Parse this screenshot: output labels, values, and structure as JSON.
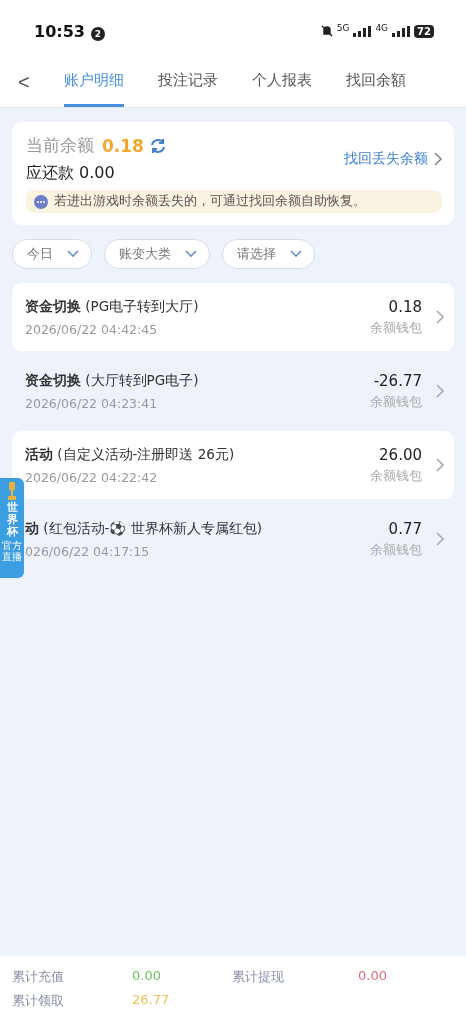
{
  "status_bar": {
    "time": "10:53",
    "notification_count": "2",
    "network_labels": [
      "5G",
      "4G"
    ],
    "battery": "72"
  },
  "nav": {
    "back": "<",
    "tabs": [
      {
        "label": "账户明细",
        "selected": true
      },
      {
        "label": "投注记录",
        "selected": false
      },
      {
        "label": "个人报表",
        "selected": false
      },
      {
        "label": "找回余額",
        "selected": false
      }
    ]
  },
  "balance_card": {
    "label": "当前余额",
    "amount": "0.18",
    "repay_label": "应还款 0.00",
    "recover_link": "找回丢失余额",
    "notice": "若进出游戏时余额丢失的，可通过找回余额自助恢复。"
  },
  "filters": [
    {
      "label": "今日"
    },
    {
      "label": "账变大类"
    },
    {
      "label": "请选择"
    }
  ],
  "records": [
    {
      "title": "**资金切换** (PG电子转到大厅)",
      "time": "2026/06/22 04:42:45",
      "amount": "0.18",
      "wallet": "余额钱包",
      "highlighted": true
    },
    {
      "title": "**资金切换** (大厅转到PG电子)",
      "time": "2026/06/22 04:23:41",
      "amount": "-26.77",
      "wallet": "余额钱包",
      "highlighted": false
    },
    {
      "title": "**活动** (自定义活动-注册即送 26元)",
      "time": "2026/06/22 04:22:42",
      "amount": "26.00",
      "wallet": "余额钱包",
      "highlighted": true
    },
    {
      "title": "**动** (红包活动-⚽ 世界杯新人专属红包)",
      "time": "026/06/22 04:17:15",
      "amount": "0.77",
      "wallet": "余额钱包",
      "highlighted": false
    }
  ],
  "floating_badge": {
    "title": "世界杯",
    "subtitle": "官方直播"
  },
  "summary": [
    {
      "label": "累计充值",
      "value": "0.00",
      "color": "#6cc35a"
    },
    {
      "label": "累计提现",
      "value": "0.00",
      "color": "#e06a7c"
    },
    {
      "label": "累计领取",
      "value": "26.77",
      "color": "#f0c050"
    }
  ]
}
